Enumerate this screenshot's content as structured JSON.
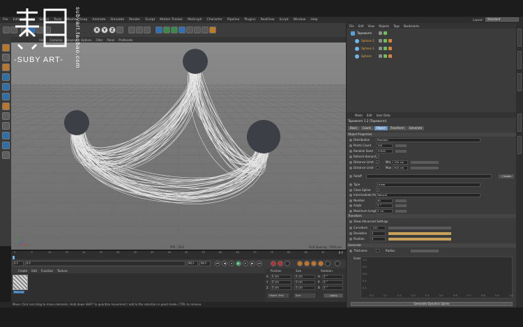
{
  "menu": {
    "items": [
      "File",
      "Edit",
      "Create",
      "Select",
      "Tools",
      "Mesh",
      "Snap",
      "Animate",
      "Simulate",
      "Render",
      "Sculpt",
      "Motion Tracker",
      "MoGraph",
      "Character",
      "Pipeline",
      "Plugins",
      "RealFlow",
      "Script",
      "Window",
      "Help"
    ]
  },
  "layout": {
    "label": "Layout:",
    "value": "Standard"
  },
  "viewport": {
    "menu": [
      "View",
      "Cameras",
      "Display",
      "Options",
      "Filter",
      "Panel",
      "ProRender"
    ],
    "fps_label": "FPS : 20.0",
    "grid_label": "Grid Spacing : 1000 cm"
  },
  "timeline": {
    "ticks": [
      "0",
      "5",
      "10",
      "15",
      "20",
      "25",
      "30",
      "35",
      "40",
      "45",
      "50",
      "55",
      "60",
      "65",
      "70",
      "75",
      "80",
      "85",
      "90"
    ],
    "end_label": "0 F",
    "start_field": "0 F",
    "current_field": "0 F",
    "end_field": "90 F",
    "max_field": "90 F"
  },
  "materials": {
    "menu": [
      "Create",
      "Edit",
      "Function",
      "Texture"
    ],
    "swatch_label": "Material"
  },
  "coordinates": {
    "headers": [
      "Position",
      "Size",
      "Rotation"
    ],
    "rows": [
      {
        "axis": "X",
        "pos": "0 cm",
        "size": "0 cm",
        "rotaxis": "H",
        "rot": "0 °"
      },
      {
        "axis": "Y",
        "pos": "0 cm",
        "size": "0 cm",
        "rotaxis": "P",
        "rot": "0 °"
      },
      {
        "axis": "Z",
        "pos": "0 cm",
        "size": "0 cm",
        "rotaxis": "B",
        "rot": "0 °"
      }
    ],
    "mode": "Object (Rel)",
    "size_mode": "Size",
    "apply": "Apply"
  },
  "status": {
    "text": "Move: Click and drag to move elements. Hold down SHIFT to quantize movement / add to the selection in point mode, CTRL to remove."
  },
  "object_manager": {
    "menu": [
      "File",
      "Edit",
      "View",
      "Objects",
      "Tags",
      "Bookmarks"
    ],
    "objects": [
      {
        "name": "Tapeworm",
        "top": true
      },
      {
        "name": "Sphere.2",
        "top": false
      },
      {
        "name": "Sphere.1",
        "top": false
      },
      {
        "name": "Sphere",
        "top": false
      }
    ]
  },
  "attributes": {
    "menu": [
      "Mode",
      "Edit",
      "User Data"
    ],
    "title": "Tapeworm 1.2 [Tapeworm]",
    "tabs": [
      "Basic",
      "Coord.",
      "Object",
      "Transform",
      "Generate"
    ],
    "active_tab": "Object",
    "section_object": "Object Properties",
    "props": [
      {
        "label": "Distribution",
        "value": "Random"
      },
      {
        "label": "Points Count",
        "value": "100"
      },
      {
        "label": "Random Seed",
        "value": "12345"
      },
      {
        "label": "Refresh Hierarchy",
        "value": "✓"
      },
      {
        "label": "Distance Limit",
        "value": "✓",
        "extra_label": "Min",
        "extra_value": "100 cm"
      },
      {
        "label": "Distance Limit",
        "value": "",
        "extra_label": "Max",
        "extra_value": "500 cm"
      }
    ],
    "falloff_label": "Falloff",
    "create_label": "Create",
    "spline_props": [
      {
        "label": "Type",
        "value": "Linear"
      },
      {
        "label": "Close Spline",
        "value": "✓"
      },
      {
        "label": "Intermediate Points",
        "value": "Natural"
      },
      {
        "label": "Number",
        "value": "40"
      },
      {
        "label": "Angle",
        "value": "5 °"
      },
      {
        "label": "Maximum Length",
        "value": "5 cm"
      }
    ],
    "section_transform": "Transform",
    "show_advanced": "Show Advanced Settings",
    "transform_props": [
      {
        "label": "Curvature",
        "value": "-100",
        "fill": 0
      },
      {
        "label": "Deviation",
        "value": "0",
        "fill": 1
      },
      {
        "label": "Position",
        "value": "0",
        "fill": 1
      }
    ],
    "section_generate": "Generate",
    "thickness_label": "Thickness",
    "radius_label": "Radius",
    "scale_label": "Scale",
    "graph_x": [
      "0.0",
      "0.1",
      "0.2",
      "0.3",
      "0.4",
      "0.5",
      "0.6",
      "0.7",
      "0.8",
      "0.9",
      "1.0"
    ],
    "graph_y": [
      "1.0",
      "0.8",
      "0.6",
      "0.4",
      "0.2"
    ],
    "generate_button": "Generate Dynamic Spline"
  },
  "watermark": {
    "text": "-SUBY ART-",
    "vertical": "subyart.taobao.com"
  }
}
